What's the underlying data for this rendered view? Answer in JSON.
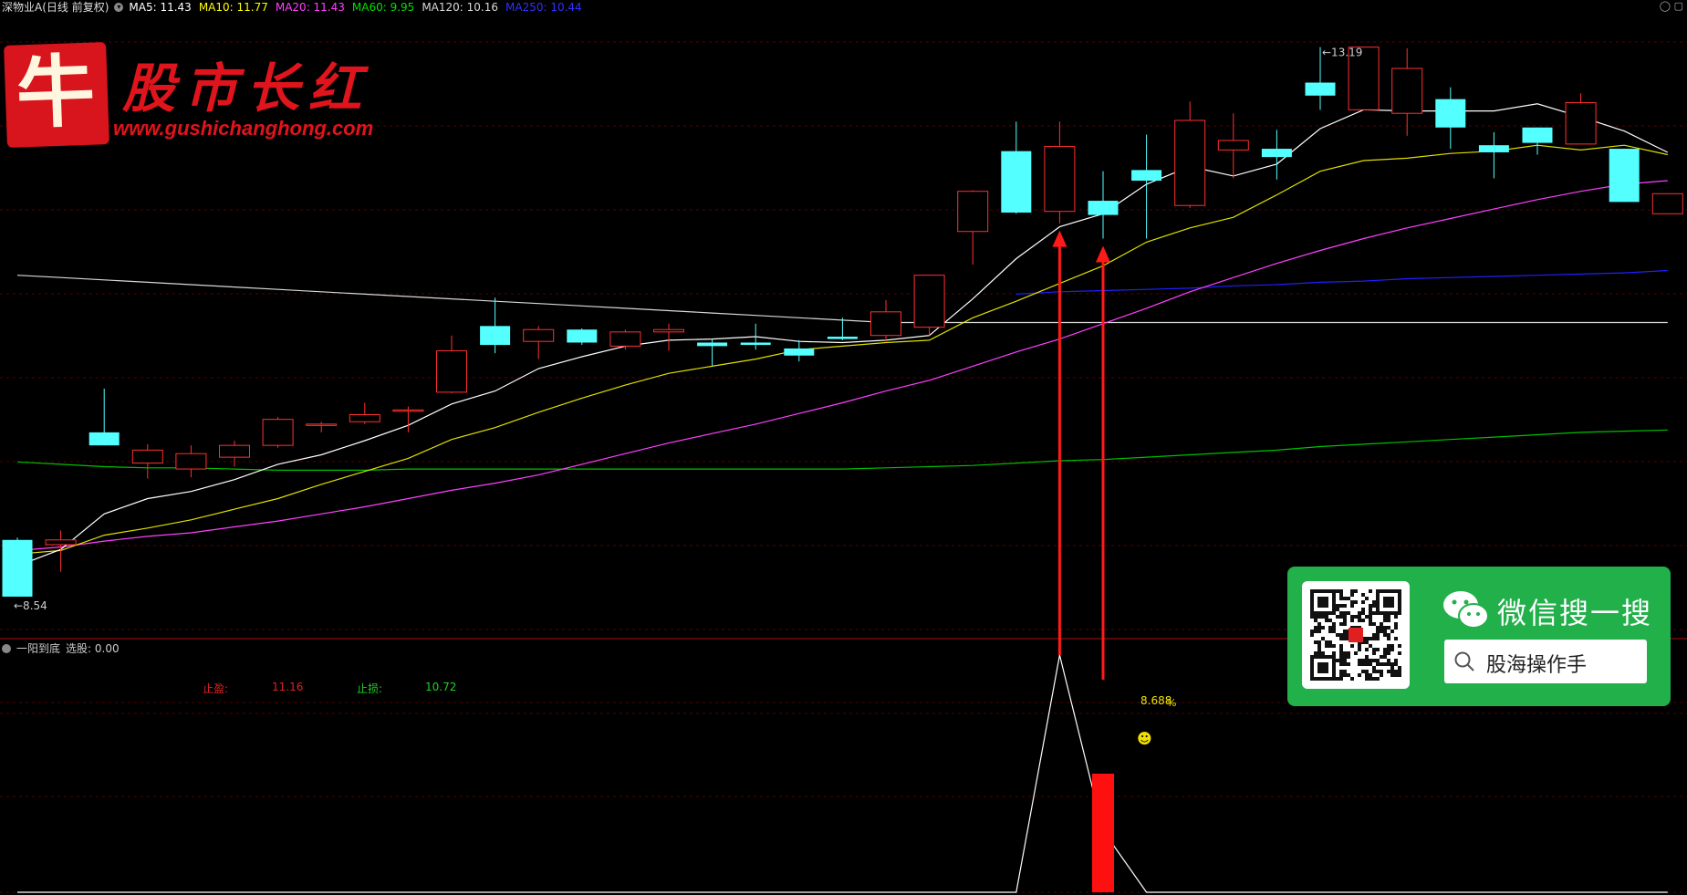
{
  "header": {
    "stock": "深物业A(日线 前复权)",
    "ma": [
      {
        "label": "MA5: 11.43",
        "color": "#ffffff"
      },
      {
        "label": "MA10: 11.77",
        "color": "#ffff00"
      },
      {
        "label": "MA20: 11.43",
        "color": "#ff40ff"
      },
      {
        "label": "MA60: 9.95",
        "color": "#00e000"
      },
      {
        "label": "MA120: 10.16",
        "color": "#d8d8d8"
      },
      {
        "label": "MA250: 10.44",
        "color": "#3030ff"
      }
    ]
  },
  "indicator": {
    "title": "一阳到底",
    "select_label": "选股: 0.00",
    "stop_loss_label": "止损:",
    "stop_loss_value": "10.72",
    "stop_gain_label": "止盈:",
    "stop_gain_value": "11.16",
    "percent_label": "8.688",
    "percent_sign": "%"
  },
  "logo": {
    "badge_char": "牛",
    "name": "股市长红",
    "url": "www.gushichanghong.com"
  },
  "wechat": {
    "title": "微信搜一搜",
    "search_text": "股海操作手"
  },
  "chart_data": {
    "type": "candlestick",
    "price_range": [
      8.2,
      13.45
    ],
    "max_label": "13.19",
    "min_label": "8.54",
    "candles": [
      {
        "o": 9.02,
        "h": 9.04,
        "l": 8.54,
        "c": 8.54
      },
      {
        "o": 8.98,
        "h": 9.1,
        "l": 8.75,
        "c": 9.02
      },
      {
        "o": 9.93,
        "h": 10.3,
        "l": 9.82,
        "c": 9.82
      },
      {
        "o": 9.67,
        "h": 9.83,
        "l": 9.54,
        "c": 9.78
      },
      {
        "o": 9.62,
        "h": 9.82,
        "l": 9.55,
        "c": 9.75
      },
      {
        "o": 9.72,
        "h": 9.86,
        "l": 9.64,
        "c": 9.82
      },
      {
        "o": 9.82,
        "h": 10.06,
        "l": 9.8,
        "c": 10.04
      },
      {
        "o": 10.0,
        "h": 10.02,
        "l": 9.93,
        "c": 10.0
      },
      {
        "o": 10.02,
        "h": 10.18,
        "l": 10.0,
        "c": 10.08
      },
      {
        "o": 10.12,
        "h": 10.15,
        "l": 9.93,
        "c": 10.12
      },
      {
        "o": 10.27,
        "h": 10.75,
        "l": 10.26,
        "c": 10.62
      },
      {
        "o": 10.83,
        "h": 11.07,
        "l": 10.6,
        "c": 10.67
      },
      {
        "o": 10.7,
        "h": 10.83,
        "l": 10.55,
        "c": 10.8
      },
      {
        "o": 10.8,
        "h": 10.81,
        "l": 10.67,
        "c": 10.69
      },
      {
        "o": 10.66,
        "h": 10.8,
        "l": 10.63,
        "c": 10.78
      },
      {
        "o": 10.78,
        "h": 10.85,
        "l": 10.62,
        "c": 10.8
      },
      {
        "o": 10.69,
        "h": 10.72,
        "l": 10.49,
        "c": 10.66
      },
      {
        "o": 10.69,
        "h": 10.85,
        "l": 10.63,
        "c": 10.67
      },
      {
        "o": 10.64,
        "h": 10.71,
        "l": 10.53,
        "c": 10.58
      },
      {
        "o": 10.74,
        "h": 10.9,
        "l": 10.71,
        "c": 10.72
      },
      {
        "o": 10.75,
        "h": 11.05,
        "l": 10.7,
        "c": 10.95
      },
      {
        "o": 10.82,
        "h": 11.26,
        "l": 10.75,
        "c": 11.26
      },
      {
        "o": 11.63,
        "h": 11.98,
        "l": 11.35,
        "c": 11.97
      },
      {
        "o": 12.31,
        "h": 12.56,
        "l": 11.78,
        "c": 11.79
      },
      {
        "o": 11.8,
        "h": 12.56,
        "l": 11.7,
        "c": 12.35
      },
      {
        "o": 11.89,
        "h": 12.14,
        "l": 11.57,
        "c": 11.77
      },
      {
        "o": 12.15,
        "h": 12.45,
        "l": 11.57,
        "c": 12.06
      },
      {
        "o": 11.85,
        "h": 12.73,
        "l": 11.83,
        "c": 12.57
      },
      {
        "o": 12.32,
        "h": 12.63,
        "l": 12.08,
        "c": 12.4
      },
      {
        "o": 12.33,
        "h": 12.49,
        "l": 12.07,
        "c": 12.26
      },
      {
        "o": 12.89,
        "h": 13.19,
        "l": 12.66,
        "c": 12.78
      },
      {
        "o": 12.66,
        "h": 13.19,
        "l": 12.66,
        "c": 13.19
      },
      {
        "o": 12.63,
        "h": 13.18,
        "l": 12.44,
        "c": 13.01
      },
      {
        "o": 12.75,
        "h": 12.85,
        "l": 12.33,
        "c": 12.51
      },
      {
        "o": 12.36,
        "h": 12.47,
        "l": 12.08,
        "c": 12.3
      },
      {
        "o": 12.51,
        "h": 12.51,
        "l": 12.28,
        "c": 12.38
      },
      {
        "o": 12.37,
        "h": 12.8,
        "l": 12.37,
        "c": 12.72
      },
      {
        "o": 12.33,
        "h": 12.33,
        "l": 11.88,
        "c": 11.88
      },
      {
        "o": 11.78,
        "h": 11.95,
        "l": 11.78,
        "c": 11.95
      }
    ],
    "ma5": [
      8.8,
      8.94,
      9.24,
      9.37,
      9.43,
      9.53,
      9.66,
      9.74,
      9.86,
      9.99,
      10.17,
      10.28,
      10.47,
      10.57,
      10.66,
      10.71,
      10.72,
      10.74,
      10.7,
      10.69,
      10.71,
      10.75,
      11.06,
      11.4,
      11.67,
      11.78,
      12.03,
      12.18,
      12.1,
      12.2,
      12.5,
      12.66,
      12.65,
      12.65,
      12.65,
      12.71,
      12.6,
      12.48,
      12.3
    ],
    "ma10": [
      8.9,
      8.93,
      9.06,
      9.12,
      9.19,
      9.28,
      9.37,
      9.49,
      9.6,
      9.71,
      9.87,
      9.97,
      10.1,
      10.22,
      10.33,
      10.43,
      10.49,
      10.55,
      10.63,
      10.66,
      10.69,
      10.71,
      10.9,
      11.04,
      11.19,
      11.34,
      11.54,
      11.66,
      11.75,
      11.94,
      12.14,
      12.23,
      12.25,
      12.29,
      12.31,
      12.36,
      12.32,
      12.36,
      12.28
    ],
    "ma20": [
      8.93,
      8.96,
      9.01,
      9.05,
      9.08,
      9.13,
      9.18,
      9.24,
      9.3,
      9.37,
      9.44,
      9.5,
      9.57,
      9.66,
      9.75,
      9.84,
      9.92,
      10.0,
      10.09,
      10.18,
      10.28,
      10.37,
      10.49,
      10.61,
      10.72,
      10.85,
      10.98,
      11.12,
      11.24,
      11.36,
      11.47,
      11.57,
      11.66,
      11.74,
      11.82,
      11.9,
      11.97,
      12.03,
      12.06
    ],
    "ma60": [
      9.68,
      9.66,
      9.64,
      9.63,
      9.63,
      9.62,
      9.61,
      9.61,
      9.61,
      9.62,
      9.62,
      9.62,
      9.62,
      9.62,
      9.62,
      9.62,
      9.62,
      9.62,
      9.62,
      9.62,
      9.63,
      9.64,
      9.65,
      9.67,
      9.69,
      9.7,
      9.72,
      9.74,
      9.76,
      9.78,
      9.81,
      9.83,
      9.85,
      9.87,
      9.89,
      9.91,
      9.93,
      9.94,
      9.95
    ],
    "ma120": [
      11.26,
      11.24,
      11.22,
      11.2,
      11.18,
      11.16,
      11.14,
      11.12,
      11.1,
      11.08,
      11.06,
      11.04,
      11.02,
      11.0,
      10.98,
      10.96,
      10.94,
      10.92,
      10.9,
      10.88,
      10.86,
      10.86,
      10.86,
      10.86,
      10.86,
      10.86,
      10.86,
      10.86,
      10.86,
      10.86,
      10.86,
      10.86,
      10.86,
      10.86,
      10.86,
      10.86,
      10.86,
      10.86,
      10.86
    ],
    "ma250": [
      null,
      null,
      null,
      null,
      null,
      null,
      null,
      null,
      null,
      null,
      null,
      null,
      null,
      null,
      null,
      null,
      null,
      null,
      null,
      null,
      null,
      null,
      null,
      11.1,
      11.12,
      11.13,
      11.14,
      11.15,
      11.17,
      11.18,
      11.2,
      11.21,
      11.23,
      11.24,
      11.25,
      11.26,
      11.27,
      11.28,
      11.3
    ],
    "indicator_line": [
      0,
      0,
      0,
      0,
      0,
      0,
      0,
      0,
      0,
      0,
      0,
      0,
      0,
      0,
      0,
      0,
      0,
      0,
      0,
      0,
      0,
      0,
      0,
      0,
      1,
      0.26,
      0,
      0,
      0,
      0,
      0,
      0,
      0,
      0,
      0,
      0,
      0,
      0,
      0
    ],
    "signal_bar_index": 25,
    "signal_bar_value": 0.5,
    "arrow_indices": [
      24,
      25
    ]
  }
}
